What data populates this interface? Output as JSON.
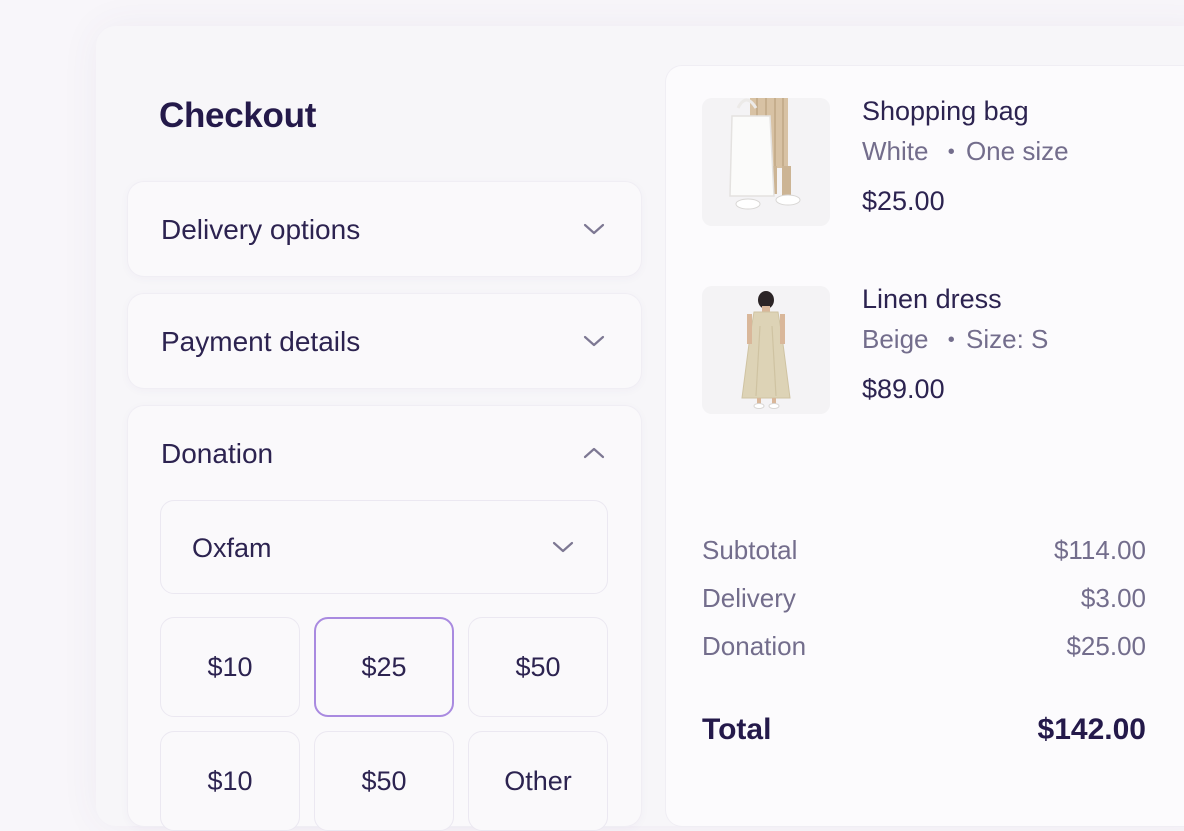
{
  "checkout": {
    "title": "Checkout",
    "sections": {
      "delivery": {
        "label": "Delivery options",
        "icon": "chevron-down-icon"
      },
      "payment": {
        "label": "Payment details",
        "icon": "chevron-down-icon"
      },
      "donation": {
        "label": "Donation",
        "icon": "chevron-up-icon",
        "charity": {
          "selected": "Oxfam",
          "icon": "chevron-down-icon"
        },
        "amounts": [
          "$10",
          "$25",
          "$50",
          "$10",
          "$50",
          "Other"
        ],
        "selected_amount": "$25"
      }
    }
  },
  "cart": {
    "items": [
      {
        "name": "Shopping bag",
        "color": "White",
        "size": "One size",
        "price": "$25.00",
        "image": "shopping-bag-photo"
      },
      {
        "name": "Linen dress",
        "color": "Beige",
        "size": "Size: S",
        "price": "$89.00",
        "image": "linen-dress-photo"
      }
    ],
    "separator": "•",
    "summary": {
      "subtotal": {
        "label": "Subtotal",
        "value": "$114.00"
      },
      "delivery": {
        "label": "Delivery",
        "value": "$3.00"
      },
      "donation": {
        "label": "Donation",
        "value": "$25.00"
      },
      "total": {
        "label": "Total",
        "value": "$142.00"
      }
    }
  },
  "colors": {
    "accent": "#a98ae0",
    "heading": "#24194a",
    "text": "#2c2350",
    "muted": "#736d8c",
    "background": "#f8f6fa"
  }
}
